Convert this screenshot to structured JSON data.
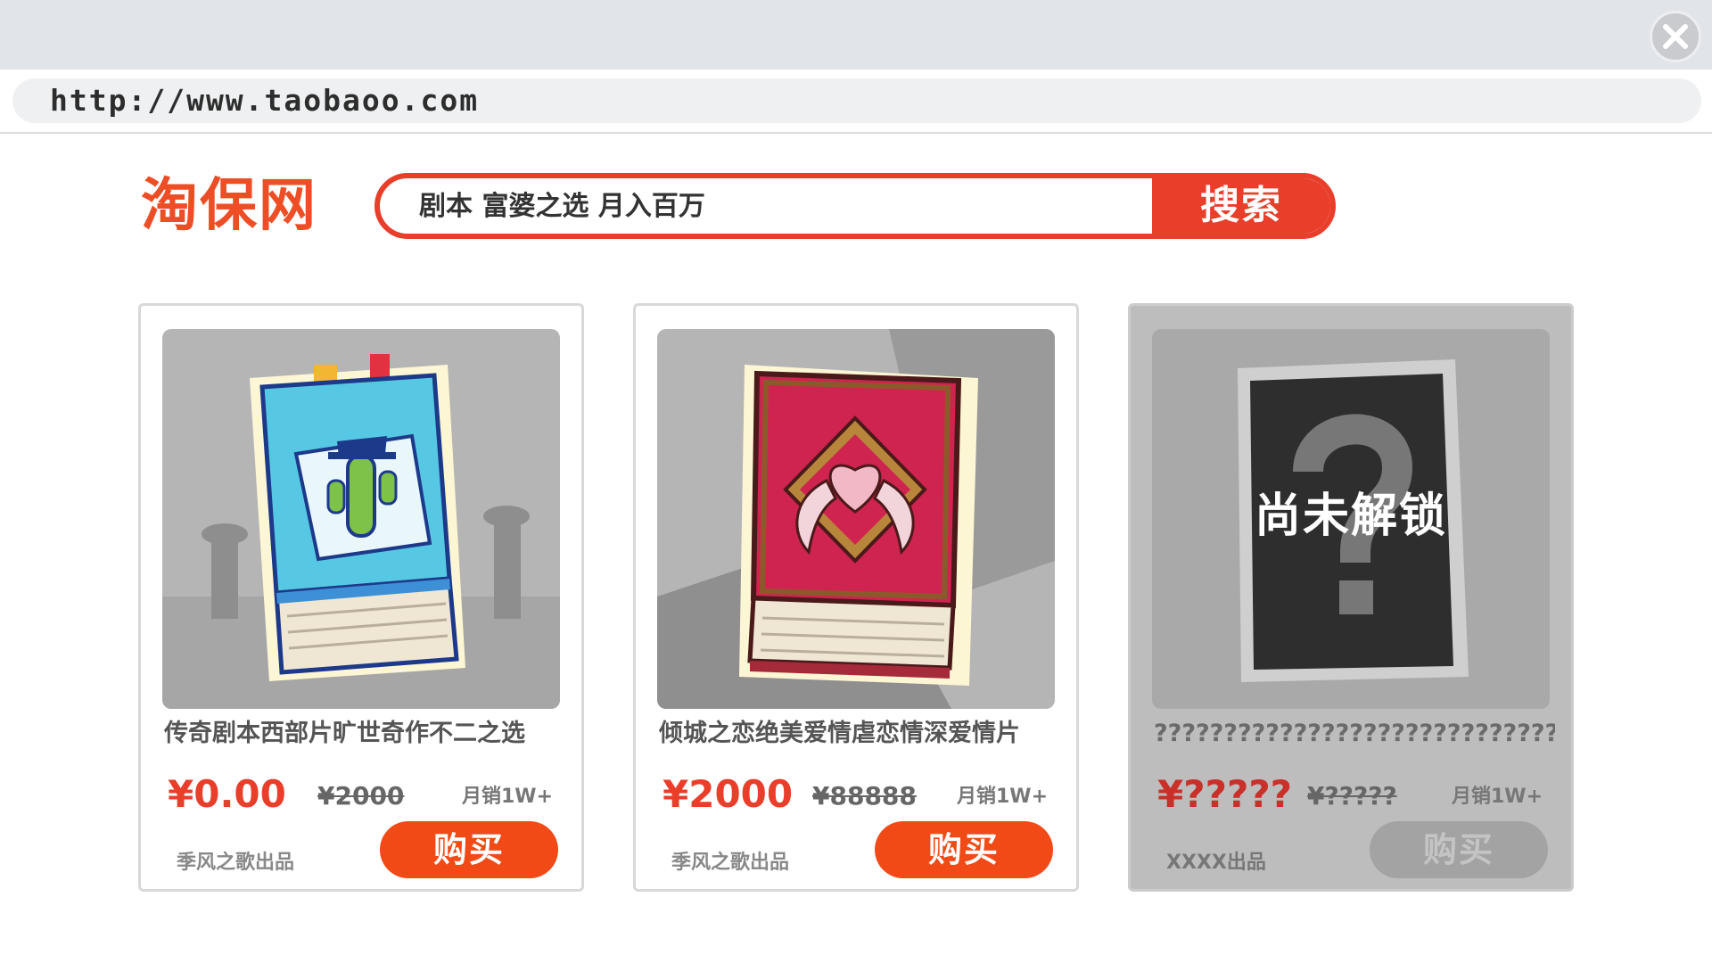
{
  "browser": {
    "url": "http://www.taobaoo.com",
    "close_icon": "close-icon"
  },
  "site": {
    "logo": "淘保网",
    "search": {
      "value": "剧本 富婆之选 月入百万",
      "button_label": "搜索"
    }
  },
  "products": [
    {
      "image_icon": "western-book-icon",
      "title": "传奇剧本西部片旷世奇作不二之选",
      "price": "¥0.00",
      "original_price": "¥2000",
      "monthly_sales": "月销1W+",
      "maker": "季风之歌出品",
      "buy_label": "购买",
      "locked": false
    },
    {
      "image_icon": "romance-book-icon",
      "title": "倾城之恋绝美爱情虐恋情深爱情片",
      "price": "¥2000",
      "original_price": "¥88888",
      "monthly_sales": "月销1W+",
      "maker": "季风之歌出品",
      "buy_label": "购买",
      "locked": false
    },
    {
      "image_icon": "question-mark-icon",
      "lock_label": "尚未解锁",
      "title": "?????????????????????????????????",
      "price": "¥?????",
      "original_price": "¥?????",
      "monthly_sales": "月销1W+",
      "maker": "XXXX出品",
      "buy_label": "购买",
      "locked": true
    }
  ]
}
